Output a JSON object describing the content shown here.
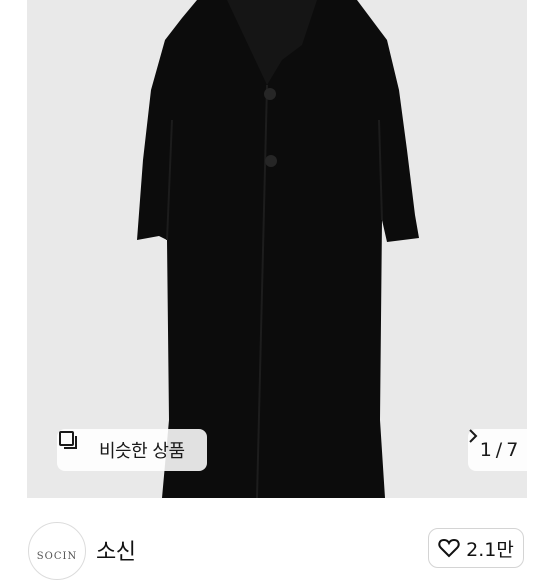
{
  "gallery": {
    "similar_label": "비슷한 상품",
    "current_index": "1",
    "separator": "/",
    "total": "7",
    "image_subject": "black-long-coat"
  },
  "seller": {
    "avatar_text": "SOCIN",
    "name": "소신",
    "likes": "2.1만"
  },
  "icons": {
    "similar": "similar-products-icon",
    "next": "chevron-right-icon",
    "like": "heart-outline-icon"
  },
  "colors": {
    "photo_background": "#e9e9e9",
    "coat": "#0c0c0c"
  }
}
